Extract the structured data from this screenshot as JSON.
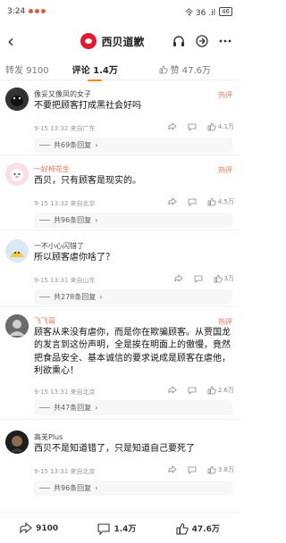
{
  "status_bar": {
    "time": "3:24",
    "right_text": "令 36 .il",
    "battery": "46"
  },
  "nav": {
    "title": "西贝道歉",
    "back_icon": "back-arrow-icon"
  },
  "tabs": [
    {
      "label": "转发 9100"
    },
    {
      "label": "评论 1.4万"
    },
    {
      "label": "赞 47.6万"
    }
  ],
  "comments": [
    {
      "name": "像妥又像凤的女子",
      "badge": "热评",
      "text": "不要把顾客打成黑社会好吗",
      "meta": "9-15 13:32 来自广东",
      "share": "",
      "reply_count": "",
      "likes": "4.1万",
      "replies": "共69条回复"
    },
    {
      "name": "一好柿花生",
      "badge": "热评",
      "text": "西贝，只有顾客是现实的。",
      "meta": "9-15 13:32 来自北京",
      "share": "",
      "reply_count": "",
      "likes": "4.5万",
      "replies": "共96条回复"
    },
    {
      "name": "一不小心闪错了",
      "badge": "",
      "text": "所以顾客虐你啥了？",
      "meta": "9-15 13:31 来自山东",
      "share": "",
      "reply_count": "",
      "likes": "3万",
      "replies": "共278条回复"
    },
    {
      "name": "飞飞哥",
      "badge": "热评",
      "text": "顾客从来没有虐你，而是你在欺骗顾客。从贾国龙的发言到这份声明，全是挨在明面上的傲慢，竟然把食品安全、基本诚信的要求说成是顾客在虐他，利欲熏心！",
      "meta": "9-15 13:31 来自北京",
      "share": "",
      "reply_count": "",
      "likes": "2.6万",
      "replies": "共47条回复"
    },
    {
      "name": "高羌Plus",
      "badge": "",
      "text": "西贝不是知道错了，只是知道自己要死了",
      "meta": "9-15 13:31 来自北京",
      "share": "",
      "reply_count": "",
      "likes": "3.8万",
      "replies": "共96条回复"
    }
  ],
  "bottom": {
    "reposts": "9100",
    "comments": "1.4万",
    "likes": "47.6万"
  }
}
